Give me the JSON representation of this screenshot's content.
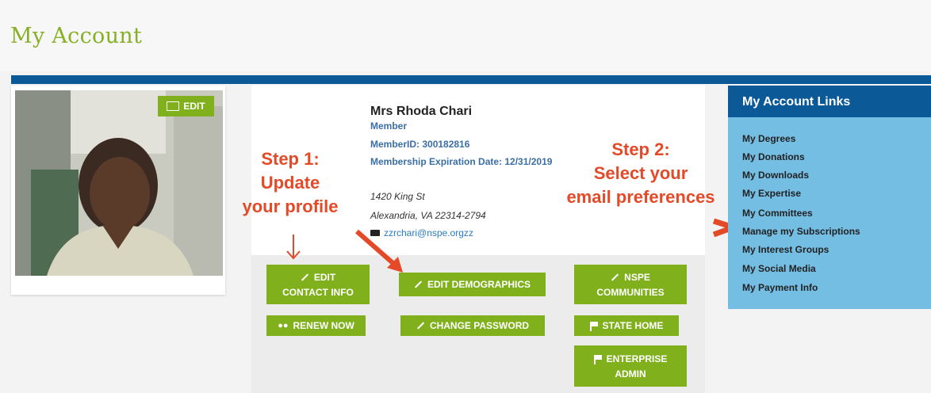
{
  "page_title": "My Account",
  "photo": {
    "edit_label": "EDIT"
  },
  "profile": {
    "name": "Mrs Rhoda Chari",
    "member_type": "Member",
    "member_id": "MemberID: 300182816",
    "expiration": "Membership Expiration Date: 12/31/2019",
    "address_line1": "1420 King St",
    "address_line2": "Alexandria, VA 22314-2794",
    "email": "zzrchari@nspe.orgzz"
  },
  "buttons": {
    "edit_contact_line1": "EDIT",
    "edit_contact_line2": "CONTACT INFO",
    "edit_demographics": "EDIT DEMOGRAPHICS",
    "nspe_line1": "NSPE",
    "nspe_line2": "COMMUNITIES",
    "renew": "RENEW NOW",
    "change_password": "CHANGE PASSWORD",
    "state_home": "STATE HOME",
    "enterprise_line1": "ENTERPRISE",
    "enterprise_line2": "ADMIN"
  },
  "annotations": {
    "step1_line1": "Step 1:",
    "step1_line2": "Update",
    "step1_line3": "your profile",
    "step2_line1": "Step 2:",
    "step2_line2": "Select your",
    "step2_line3": "email preferences",
    "color": "#e44a28"
  },
  "links": {
    "header": "My Account Links",
    "items": [
      "My Degrees",
      "My Donations",
      "My Downloads",
      "My Expertise",
      "My Committees",
      "Manage my Subscriptions",
      "My Interest Groups",
      "My Social Media",
      "My Payment Info"
    ]
  },
  "colors": {
    "accent_green": "#80b11c",
    "title_green": "#88b027",
    "brand_blue": "#0b5a97",
    "links_bg": "#74bde3"
  }
}
